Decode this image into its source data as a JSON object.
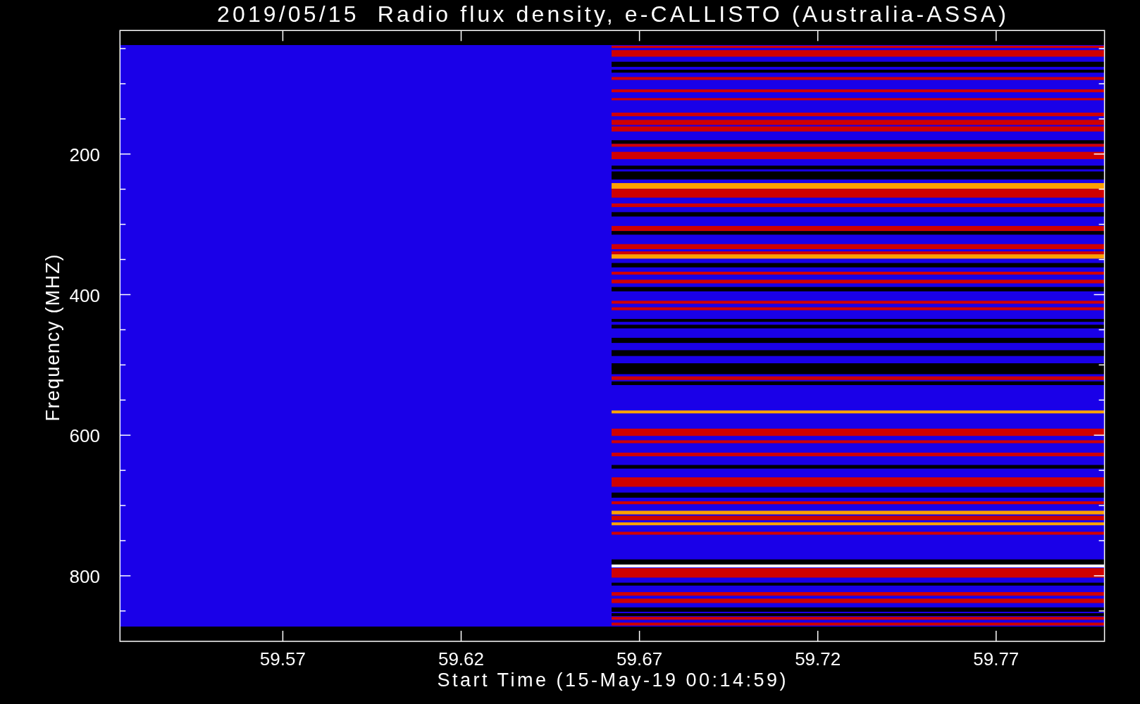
{
  "plot": {
    "title": "2019/05/15  Radio flux density, e-CALLISTO (Australia-ASSA)",
    "xlabel": "Start Time (15-May-19 00:14:59)",
    "ylabel": "Frequency (MHZ)",
    "xticks": [
      "59.57",
      "59.62",
      "59.67",
      "59.72",
      "59.77"
    ],
    "yticks": [
      "200",
      "400",
      "600",
      "800"
    ]
  }
}
